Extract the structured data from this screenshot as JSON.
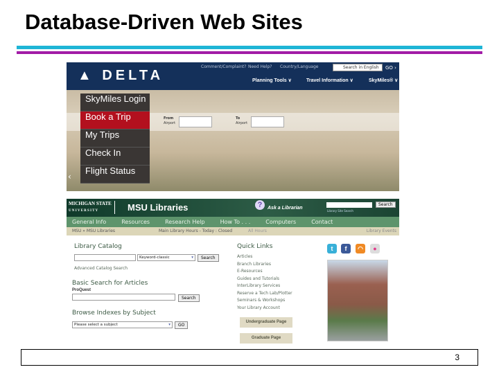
{
  "slide": {
    "title": "Database-Driven Web Sites",
    "page_number": "3",
    "rule_colors": [
      "#1fb5d6",
      "#a21ca6"
    ]
  },
  "delta": {
    "logo": "DELTA",
    "top_links": [
      "Comment/Complaint?",
      "Need Help?",
      "Country/Language"
    ],
    "search_placeholder": "Search in English",
    "go": "GO ›",
    "nav": [
      "Planning Tools ∨",
      "Travel Information ∨",
      "SkyMiles® ∨"
    ],
    "menu": [
      "SkyMiles Login",
      "Book a Trip",
      "My Trips",
      "Check In",
      "Flight Status"
    ],
    "from_label": "From",
    "from_sub": "Airport",
    "to_label": "To",
    "to_sub": "Airport",
    "brand_color": "#b3101e"
  },
  "msu": {
    "logo_line1": "MICHIGAN STATE",
    "logo_line2": "U N I V E R S I T Y",
    "title": "MSU Libraries",
    "ask": "Ask a Librarian",
    "site_search_label": "Library Site Search",
    "search_btn": "Search",
    "nav": [
      "General Info",
      "Resources",
      "Research Help",
      "How To . . .",
      "Computers",
      "Contact"
    ],
    "breadcrumb": "MSU » MSU Libraries",
    "hours": "Main Library Hours - Today : Closed",
    "all_hours": "All Hours",
    "events": "Library Events",
    "catalog": {
      "heading": "Library Catalog",
      "select": "Keyword-classic",
      "button": "Search",
      "advanced": "Advanced Catalog Search"
    },
    "articles": {
      "heading": "Basic Search for Articles",
      "sub": "ProQuest",
      "button": "Search"
    },
    "browse": {
      "heading": "Browse Indexes by Subject",
      "select": "Please select a subject",
      "button": "GO"
    },
    "quick_links": {
      "heading": "Quick Links",
      "items": [
        "Articles",
        "Branch Libraries",
        "E-Resources",
        "Guides and Tutorials",
        "InterLibrary Services",
        "Reserve a Tech Lab/Plotter",
        "Seminars & Workshops",
        "Your Library Account"
      ]
    },
    "undergrad": "Undergraduate Page",
    "grad": "Graduate Page",
    "social_icons": [
      "twitter-icon",
      "facebook-icon",
      "rss-icon",
      "flickr-icon"
    ]
  }
}
